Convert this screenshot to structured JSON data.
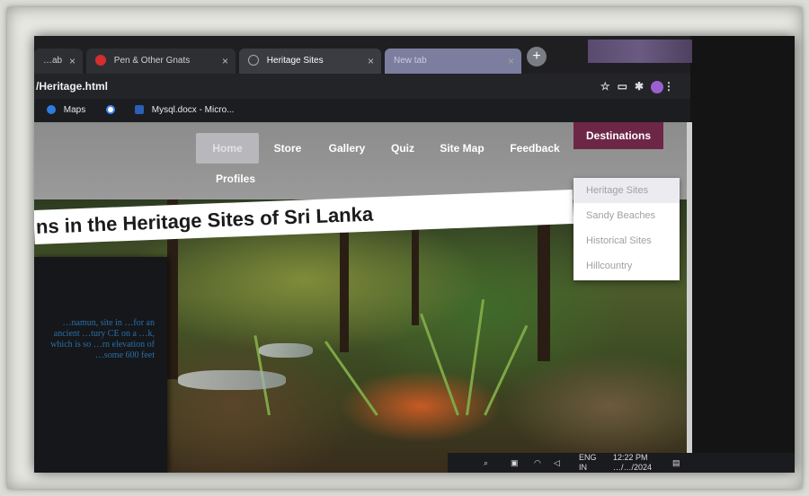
{
  "tabs": [
    {
      "label": "…ab",
      "state": "background"
    },
    {
      "label": "Pen & Other Gnats",
      "state": "background"
    },
    {
      "label": "Heritage Sites",
      "state": "active"
    },
    {
      "label": "New tab",
      "state": "faded"
    }
  ],
  "newtab_symbol": "+",
  "address": {
    "url": "/Heritage.html"
  },
  "bookmarks": [
    {
      "label": "Maps",
      "icon": "maps-pin-icon"
    },
    {
      "label": "",
      "icon": "google-icon"
    },
    {
      "label": "Mysql.docx - Micro...",
      "icon": "word-doc-icon"
    }
  ],
  "nav": {
    "items": [
      "Home",
      "Store",
      "Gallery",
      "Quiz",
      "Site Map",
      "Feedback"
    ],
    "destinations": "Destinations",
    "second_row": "Profiles"
  },
  "dropdown": {
    "items": [
      "Heritage Sites",
      "Sandy Beaches",
      "Historical Sites",
      "Hillcountry"
    ]
  },
  "hero": {
    "title": "ns in the Heritage Sites of Sri Lanka",
    "side_text": "…namun, site in …for an ancient …tury CE on a …k, which is so …rn elevation of …some 600 feet"
  },
  "taskbar": {
    "lang": "ENG",
    "lang_sub": "IN",
    "time": "12:22 PM",
    "date": "…/…/2024"
  },
  "colors": {
    "nav_bg": "#8c8c8c",
    "destinations_bg": "#6e2647",
    "dropdown_text": "#9fa0a6"
  }
}
